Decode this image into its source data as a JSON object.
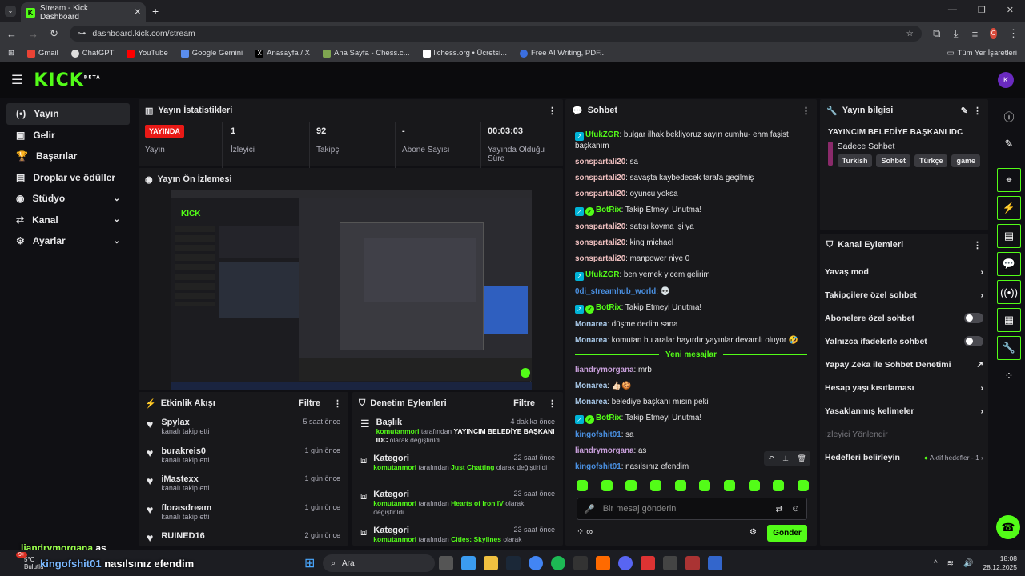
{
  "browser": {
    "tab_title": "Stream - Kick Dashboard",
    "url": "dashboard.kick.com/stream",
    "bookmarks": [
      "Gmail",
      "ChatGPT",
      "YouTube",
      "Google Gemini",
      "Anasayfa / X",
      "Ana Sayfa - Chess.c...",
      "lichess.org • Ücretsi...",
      "Free AI Writing, PDF..."
    ],
    "all_bookmarks": "Tüm Yer İşaretleri",
    "profile_letter": "C"
  },
  "header": {
    "logo": "KICK",
    "beta": "BETA"
  },
  "sidebar": [
    {
      "label": "Yayın",
      "icon": "(•)"
    },
    {
      "label": "Gelir",
      "icon": "▣"
    },
    {
      "label": "Başarılar",
      "icon": "🏆"
    },
    {
      "label": "Droplar ve ödüller",
      "icon": "▤"
    },
    {
      "label": "Stüdyo",
      "icon": "◉"
    },
    {
      "label": "Kanal",
      "icon": "⇄"
    },
    {
      "label": "Ayarlar",
      "icon": "⚙"
    }
  ],
  "stats": {
    "title": "Yayın İstatistikleri",
    "live": "YAYINDA",
    "live_label": "Yayın",
    "viewers": "1",
    "viewers_label": "İzleyici",
    "followers": "92",
    "followers_label": "Takipçi",
    "subs": "-",
    "subs_label": "Abone Sayısı",
    "uptime": "00:03:03",
    "uptime_label": "Yayında Olduğu Süre"
  },
  "preview": {
    "title": "Yayın Ön İzlemesi"
  },
  "activity": {
    "title": "Etkinlik Akışı",
    "filter": "Filtre",
    "items": [
      {
        "name": "Spylax",
        "sub": "kanalı takip etti",
        "time": "5 saat önce"
      },
      {
        "name": "burakreis0",
        "sub": "kanalı takip etti",
        "time": "1 gün önce"
      },
      {
        "name": "iMastexx",
        "sub": "kanalı takip etti",
        "time": "1 gün önce"
      },
      {
        "name": "florasdream",
        "sub": "kanalı takip etti",
        "time": "1 gün önce"
      },
      {
        "name": "RUINED16",
        "sub": "",
        "time": "2 gün önce"
      }
    ]
  },
  "moderation": {
    "title": "Denetim Eylemleri",
    "filter": "Filtre",
    "items": [
      {
        "type": "Başlık",
        "by": "komutanmori",
        "mid": "tarafından",
        "value": "YAYINCIM BELEDİYE BAŞKANI IDC",
        "end": "olarak değiştirildi",
        "time": "4 dakika önce"
      },
      {
        "type": "Kategori",
        "by": "komutanmori",
        "mid": "tarafından",
        "value": "Just Chatting",
        "end": "olarak değiştirildi",
        "time": "22 saat önce"
      },
      {
        "type": "Kategori",
        "by": "komutanmori",
        "mid": "tarafından",
        "value": "Hearts of Iron IV",
        "end": "olarak değiştirildi",
        "time": "23 saat önce"
      },
      {
        "type": "Kategori",
        "by": "komutanmori",
        "mid": "tarafından",
        "value": "Cities: Skylines",
        "end": "olarak",
        "time": "23 saat önce"
      }
    ]
  },
  "chat": {
    "title": "Sohbet",
    "messages": [
      {
        "user": "UfukZGR",
        "color": "#53fc18",
        "badge": true,
        "text": "bulgar ilhak bekliyoruz sayın cumhu- ehm faşist başkanım"
      },
      {
        "user": "sonspartali20",
        "color": "#f0c0c0",
        "text": "sa"
      },
      {
        "user": "sonspartali20",
        "color": "#f0c0c0",
        "text": "savaşta kaybedecek tarafa geçilmiş"
      },
      {
        "user": "sonspartali20",
        "color": "#f0c0c0",
        "text": "oyuncu yoksa"
      },
      {
        "user": "BotRix",
        "color": "#53fc18",
        "badge": true,
        "verified": true,
        "text": "Takip Etmeyi Unutma!"
      },
      {
        "user": "sonspartali20",
        "color": "#f0c0c0",
        "text": "satışı koyma işi ya"
      },
      {
        "user": "sonspartali20",
        "color": "#f0c0c0",
        "text": "king michael"
      },
      {
        "user": "sonspartali20",
        "color": "#f0c0c0",
        "text": "manpower niye 0"
      },
      {
        "user": "UfukZGR",
        "color": "#53fc18",
        "badge": true,
        "text": "ben yemek yicem gelirim"
      },
      {
        "user": "0di_streamhub_world",
        "color": "#4a90e2",
        "text": "💀"
      },
      {
        "user": "BotRix",
        "color": "#53fc18",
        "badge": true,
        "verified": true,
        "text": "Takip Etmeyi Unutma!"
      },
      {
        "user": "Monarea",
        "color": "#a8c8e8",
        "text": "düşme dedim sana"
      },
      {
        "user": "Monarea",
        "color": "#a8c8e8",
        "text": "komutan bu aralar hayırdır yayınlar devamlı oluyor 🤣"
      }
    ],
    "new_messages": "Yeni mesajlar",
    "messages2": [
      {
        "user": "liandrymorgana",
        "color": "#c9a0dc",
        "text": "mrb"
      },
      {
        "user": "Monarea",
        "color": "#a8c8e8",
        "text": "👍🏻🍪"
      },
      {
        "user": "Monarea",
        "color": "#a8c8e8",
        "text": "belediye başkanı mısın peki"
      },
      {
        "user": "BotRix",
        "color": "#53fc18",
        "badge": true,
        "verified": true,
        "text": "Takip Etmeyi Unutma!"
      },
      {
        "user": "kingofshit01",
        "color": "#4a90e2",
        "text": "sa"
      },
      {
        "user": "liandrymorgana",
        "color": "#c9a0dc",
        "text": "as"
      },
      {
        "user": "kingofshit01",
        "color": "#4a90e2",
        "text": "nasılsınız efendim"
      }
    ],
    "placeholder": "Bir mesaj gönderin",
    "send": "Gönder"
  },
  "info": {
    "title": "Yayın bilgisi",
    "stream_title": "YAYINCIM BELEDİYE BAŞKANI IDC",
    "category": "Sadece Sohbet",
    "tags": [
      "Turkish",
      "Sohbet",
      "Türkçe",
      "game"
    ]
  },
  "channel_actions": {
    "title": "Kanal Eylemleri",
    "items": [
      {
        "label": "Yavaş mod",
        "ctl": "chev"
      },
      {
        "label": "Takipçilere özel sohbet",
        "ctl": "chev"
      },
      {
        "label": "Abonelere özel sohbet",
        "ctl": "toggle"
      },
      {
        "label": "Yalnızca ifadelerle sohbet",
        "ctl": "toggle"
      },
      {
        "label": "Yapay Zeka ile Sohbet Denetimi",
        "ctl": "ext"
      },
      {
        "label": "Hesap yaşı kısıtlaması",
        "ctl": "chev"
      },
      {
        "label": "Yasaklanmış kelimeler",
        "ctl": "chev"
      }
    ],
    "section": "İzleyici Yönlendir",
    "goals": "Hedefleri belirleyin",
    "goals_status": "Aktif hedefler - 1"
  },
  "overlay": {
    "line1_user": "liandrymorgana",
    "line1_text": "as",
    "line2_user": "kingofshit01",
    "line2_text": "nasılsınız efendim"
  },
  "taskbar": {
    "temp": "5°C",
    "weather": "Bulutlu",
    "search": "Ara",
    "time": "18:08",
    "date": "28.12.2025",
    "notif": "9+"
  }
}
